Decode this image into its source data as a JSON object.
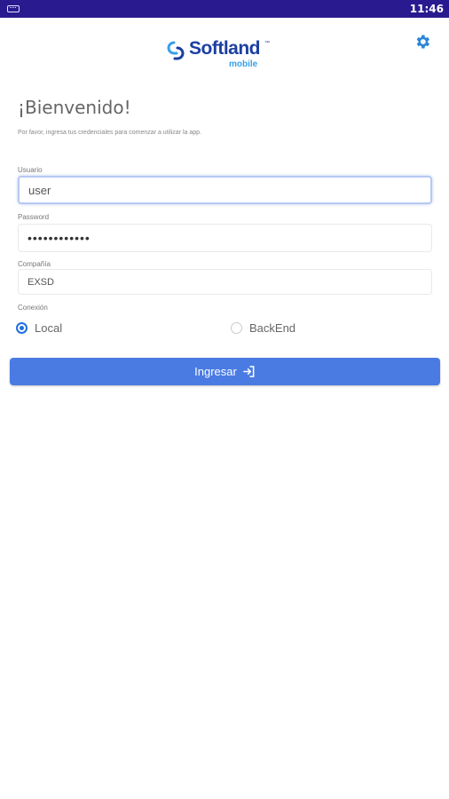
{
  "status_bar": {
    "time": "11:46"
  },
  "header": {
    "brand": "Softland",
    "trademark": "™",
    "subtitle": "mobile",
    "brand_color": "#1b3fa2",
    "accent_color": "#3aa0e8",
    "settings_icon": "gear-icon"
  },
  "login": {
    "welcome": "¡Bienvenido!",
    "hint": "Por favor, ingresa tus credenciales para comenzar a utilizar la app.",
    "user_label": "Usuario",
    "user_value": "user",
    "password_label": "Password",
    "password_value": "••••••••••••",
    "company_label": "Compañía",
    "company_value": "EXSD",
    "connection_label": "Conexión",
    "connection_options": [
      {
        "label": "Local",
        "selected": true
      },
      {
        "label": "BackEnd",
        "selected": false
      }
    ],
    "submit_label": "Ingresar",
    "submit_icon": "login-icon",
    "button_color": "#4a7be3"
  }
}
